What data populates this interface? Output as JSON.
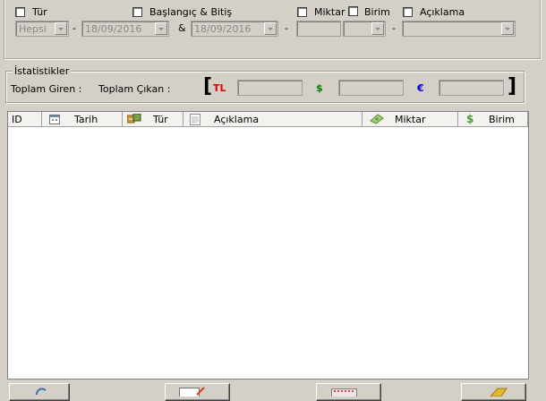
{
  "filters": {
    "tur": {
      "label": "Tür",
      "checked": false,
      "value": "Hepsi"
    },
    "tarih": {
      "label": "Başlangıç & Bitiş",
      "checked": false,
      "start": "18/09/2016",
      "end": "18/09/2016",
      "amp": "&"
    },
    "miktar": {
      "label": "Miktar",
      "checked": false,
      "value": ""
    },
    "birim": {
      "label": "Birim",
      "checked": false,
      "value": ""
    },
    "aciklama": {
      "label": "Açıklama",
      "checked": false,
      "value": ""
    },
    "dash": "-"
  },
  "stats": {
    "title": "İstatistikler",
    "toplam_giren": "Toplam Giren :",
    "toplam_cikan": "Toplam Çıkan :",
    "bracket_open": "[",
    "bracket_close": "]",
    "currencies": [
      {
        "symbol": "TL",
        "color": "#e00000",
        "value": ""
      },
      {
        "symbol": "$",
        "color": "#008000",
        "value": ""
      },
      {
        "symbol": "€",
        "color": "#0000d0",
        "value": ""
      }
    ]
  },
  "table": {
    "columns": [
      {
        "label": "ID",
        "icon": "none"
      },
      {
        "label": "Tarih",
        "icon": "calendar-icon"
      },
      {
        "label": "Tür",
        "icon": "type-icon"
      },
      {
        "label": "Açıklama",
        "icon": "notepad-icon"
      },
      {
        "label": "Miktar",
        "icon": "money-icon"
      },
      {
        "label": "Birim",
        "icon": "dollar-icon"
      }
    ],
    "rows": []
  },
  "toolbar": {
    "buttons": [
      {
        "icon": "refresh-icon"
      },
      {
        "icon": "edit-icon"
      },
      {
        "icon": "delete-icon"
      },
      {
        "icon": "folder-icon"
      }
    ]
  }
}
